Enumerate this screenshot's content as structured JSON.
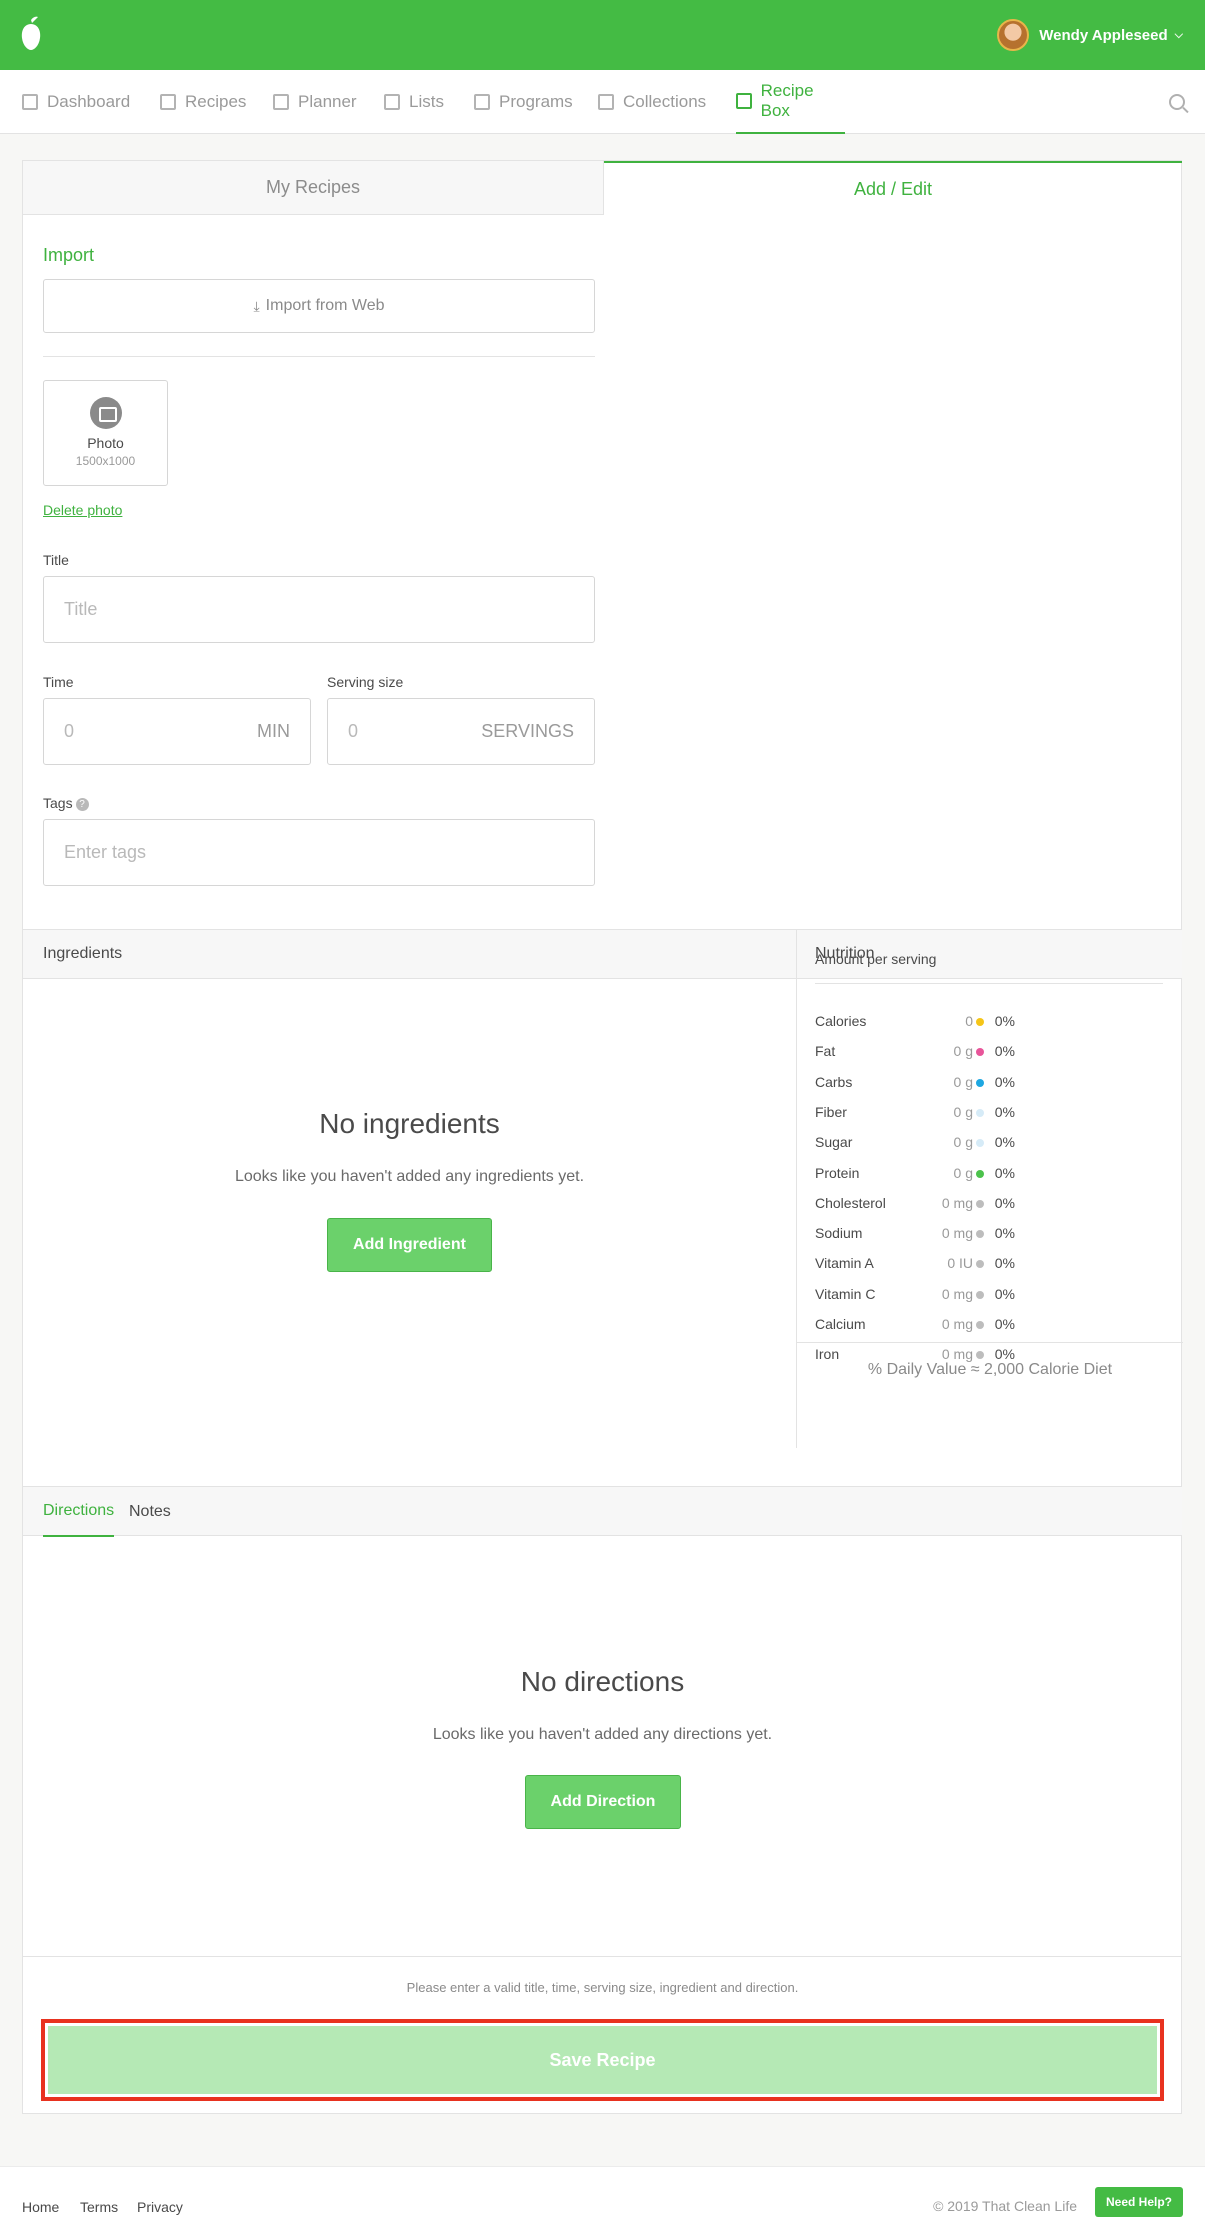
{
  "header": {
    "user_name": "Wendy Appleseed"
  },
  "nav": {
    "items": [
      {
        "label": "Dashboard"
      },
      {
        "label": "Recipes"
      },
      {
        "label": "Planner"
      },
      {
        "label": "Lists"
      },
      {
        "label": "Programs"
      },
      {
        "label": "Collections"
      },
      {
        "label": "Recipe Box",
        "active": true
      }
    ]
  },
  "tabs": {
    "my_recipes": "My Recipes",
    "add_edit": "Add / Edit"
  },
  "import": {
    "heading": "Import",
    "button": "Import from Web"
  },
  "photo": {
    "label": "Photo",
    "size": "1500x1000",
    "delete": "Delete photo"
  },
  "form": {
    "title_label": "Title",
    "title_placeholder": "Title",
    "time_label": "Time",
    "time_value": "0",
    "time_unit": "MIN",
    "serving_label": "Serving size",
    "serving_value": "0",
    "serving_unit": "SERVINGS",
    "tags_label": "Tags",
    "tags_placeholder": "Enter tags"
  },
  "ingredients": {
    "heading": "Ingredients",
    "empty_title": "No ingredients",
    "empty_sub": "Looks like you haven't added any ingredients yet.",
    "add_button": "Add Ingredient"
  },
  "nutrition": {
    "heading": "Nutrition",
    "amount_label": "Amount per serving",
    "rows": [
      {
        "name": "Calories",
        "value": "0",
        "percent": "0%",
        "color": "#f5c518"
      },
      {
        "name": "Fat",
        "value": "0 g",
        "percent": "0%",
        "color": "#e8559a"
      },
      {
        "name": "Carbs",
        "value": "0 g",
        "percent": "0%",
        "color": "#1ea7e1"
      },
      {
        "name": "Fiber",
        "value": "0 g",
        "percent": "0%",
        "color": "#d6ebf7"
      },
      {
        "name": "Sugar",
        "value": "0 g",
        "percent": "0%",
        "color": "#d6ebf7"
      },
      {
        "name": "Protein",
        "value": "0 g",
        "percent": "0%",
        "color": "#4cc24c"
      },
      {
        "name": "Cholesterol",
        "value": "0 mg",
        "percent": "0%",
        "color": "#bdbdbd"
      },
      {
        "name": "Sodium",
        "value": "0 mg",
        "percent": "0%",
        "color": "#bdbdbd"
      },
      {
        "name": "Vitamin A",
        "value": "0 IU",
        "percent": "0%",
        "color": "#bdbdbd"
      },
      {
        "name": "Vitamin C",
        "value": "0 mg",
        "percent": "0%",
        "color": "#bdbdbd"
      },
      {
        "name": "Calcium",
        "value": "0 mg",
        "percent": "0%",
        "color": "#bdbdbd"
      },
      {
        "name": "Iron",
        "value": "0 mg",
        "percent": "0%",
        "color": "#bdbdbd"
      }
    ],
    "footer": "% Daily Value ≈ 2,000 Calorie Diet"
  },
  "directions": {
    "tab_directions": "Directions",
    "tab_notes": "Notes",
    "empty_title": "No directions",
    "empty_sub": "Looks like you haven't added any directions yet.",
    "add_button": "Add Direction"
  },
  "save": {
    "message": "Please enter a valid title, time, serving size, ingredient and direction.",
    "button": "Save Recipe"
  },
  "footer": {
    "links": [
      "Home",
      "Terms",
      "Privacy"
    ],
    "copyright": "© 2019 That Clean Life",
    "help_button": "Need Help?"
  },
  "colors": {
    "brand": "#44bb44",
    "accent": "#3fb23f",
    "highlight": "#e8321f"
  }
}
